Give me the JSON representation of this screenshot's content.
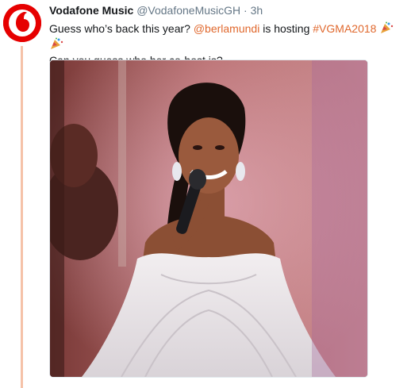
{
  "tweet": {
    "author_name": "Vodafone Music",
    "handle": "@VodafoneMusicGH",
    "separator": "·",
    "time": "3h",
    "text_part1": "Guess who’s back this year? ",
    "mention": "@berlamundi",
    "text_part2": " is hosting ",
    "hashtag": "#VGMA2018",
    "line2": "Can you guess who her co-host is?",
    "avatar_icon": "vodafone-logo-icon",
    "emoji_icons": [
      "party-popper-icon",
      "party-popper-icon"
    ],
    "media_description_icon": "photo"
  },
  "colors": {
    "brand_red": "#e60000",
    "link_orange": "#e0682d",
    "thread_line": "#f5c2a8"
  }
}
